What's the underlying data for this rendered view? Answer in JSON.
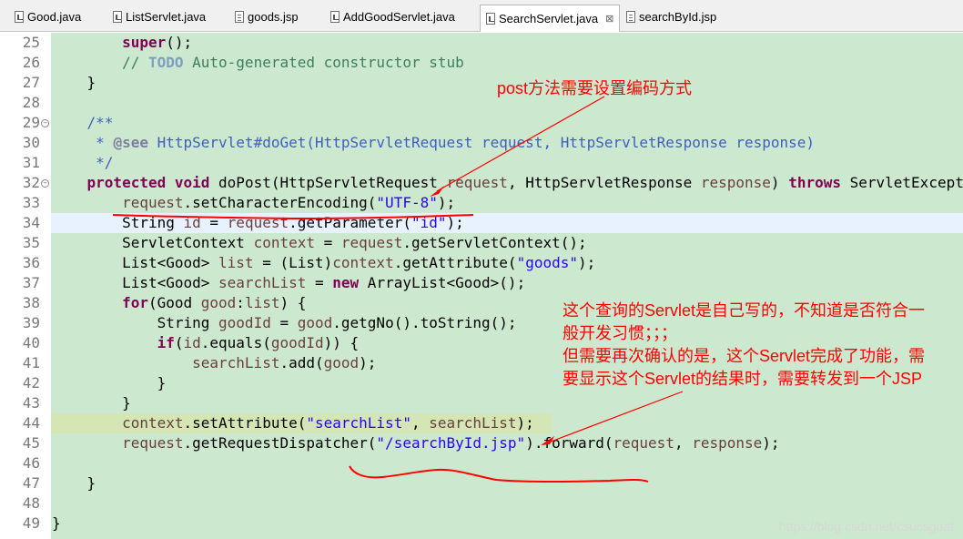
{
  "tabs": [
    {
      "label": "Good.java",
      "type": "java"
    },
    {
      "label": "ListServlet.java",
      "type": "java"
    },
    {
      "label": "goods.jsp",
      "type": "jsp"
    },
    {
      "label": "AddGoodServlet.java",
      "type": "java"
    },
    {
      "label": "SearchServlet.java",
      "type": "java",
      "active": true,
      "close": "⊠"
    },
    {
      "label": "searchById.jsp",
      "type": "jsp"
    }
  ],
  "line_numbers": [
    "25",
    "26",
    "27",
    "28",
    "29",
    "30",
    "31",
    "32",
    "33",
    "34",
    "35",
    "36",
    "37",
    "38",
    "39",
    "40",
    "41",
    "42",
    "43",
    "44",
    "45",
    "46",
    "47",
    "48",
    "49"
  ],
  "annotations": {
    "post_note": "post方法需要设置编码方式",
    "servlet_note_1": "这个查询的Servlet是自己写的，不知道是否符合一",
    "servlet_note_2": "般开发习惯；；；",
    "servlet_note_3": "但需要再次确认的是，这个Servlet完成了功能，需",
    "servlet_note_4": "要显示这个Servlet的结果时，需要转发到一个JSP"
  },
  "watermark": "https://blog.csdn.net/csucsgoat",
  "colors": {
    "annotation": "#ff0000",
    "code_bg": "#cce8cf",
    "keyword": "#7f0055",
    "string": "#2a00ff"
  }
}
